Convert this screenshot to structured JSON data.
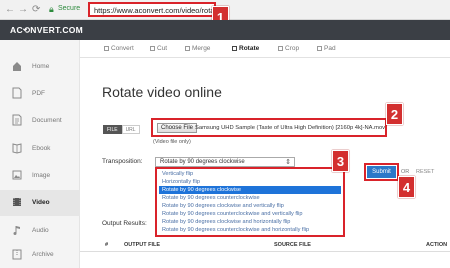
{
  "browser": {
    "back": "←",
    "forward": "→",
    "reload": "⟳",
    "secure_label": "Secure",
    "url": "https://www.aconvert.com/video/rotate/"
  },
  "badges": [
    "1",
    "2",
    "3",
    "4"
  ],
  "header": {
    "logo": "AC⟲NVERT.COM"
  },
  "sidebar": {
    "items": [
      {
        "label": "Home",
        "icon": "home-icon"
      },
      {
        "label": "PDF",
        "icon": "pdf-icon"
      },
      {
        "label": "Document",
        "icon": "document-icon"
      },
      {
        "label": "Ebook",
        "icon": "ebook-icon"
      },
      {
        "label": "Image",
        "icon": "image-icon"
      },
      {
        "label": "Video",
        "icon": "video-icon",
        "active": true
      },
      {
        "label": "Audio",
        "icon": "audio-icon"
      },
      {
        "label": "Archive",
        "icon": "archive-icon"
      }
    ]
  },
  "tabs": [
    {
      "label": "Convert"
    },
    {
      "label": "Cut"
    },
    {
      "label": "Merge"
    },
    {
      "label": "Rotate",
      "active": true
    },
    {
      "label": "Crop"
    },
    {
      "label": "Pad"
    }
  ],
  "main": {
    "title": "Rotate video online",
    "source": {
      "file": "FILE",
      "url": "URL"
    },
    "choose_file": "Choose File",
    "file_name": "Samsung UHD Sample (Taste of Ultra High Definition) [2160p 4k]-NA.mov",
    "file_note": "(Video file only)",
    "transposition_label": "Transposition:",
    "selected": "Rotate by 90 degrees clockwise",
    "options": [
      "Vertically flip",
      "Horizontally flip",
      "Rotate by 90 degrees clockwise",
      "Rotate by 90 degrees counterclockwise",
      "Rotate by 90 degrees clockwise and vertically flip",
      "Rotate by 90 degrees counterclockwise and vertically flip",
      "Rotate by 90 degrees clockwise and horizontally flip",
      "Rotate by 90 degrees counterclockwise and horizontally flip"
    ],
    "selected_index": 2,
    "submit": "Submit",
    "or": "OR",
    "reset": "RESET",
    "output_label": "Output Results:",
    "columns": [
      "#",
      "OUTPUT FILE",
      "SOURCE FILE",
      "ACTION"
    ]
  },
  "colors": {
    "header_bg": "#3b3f45",
    "highlight_red": "#d9232a",
    "submit_blue": "#2b78c9",
    "selected_option": "#1e73d9",
    "secure_green": "#2e8b3e"
  }
}
